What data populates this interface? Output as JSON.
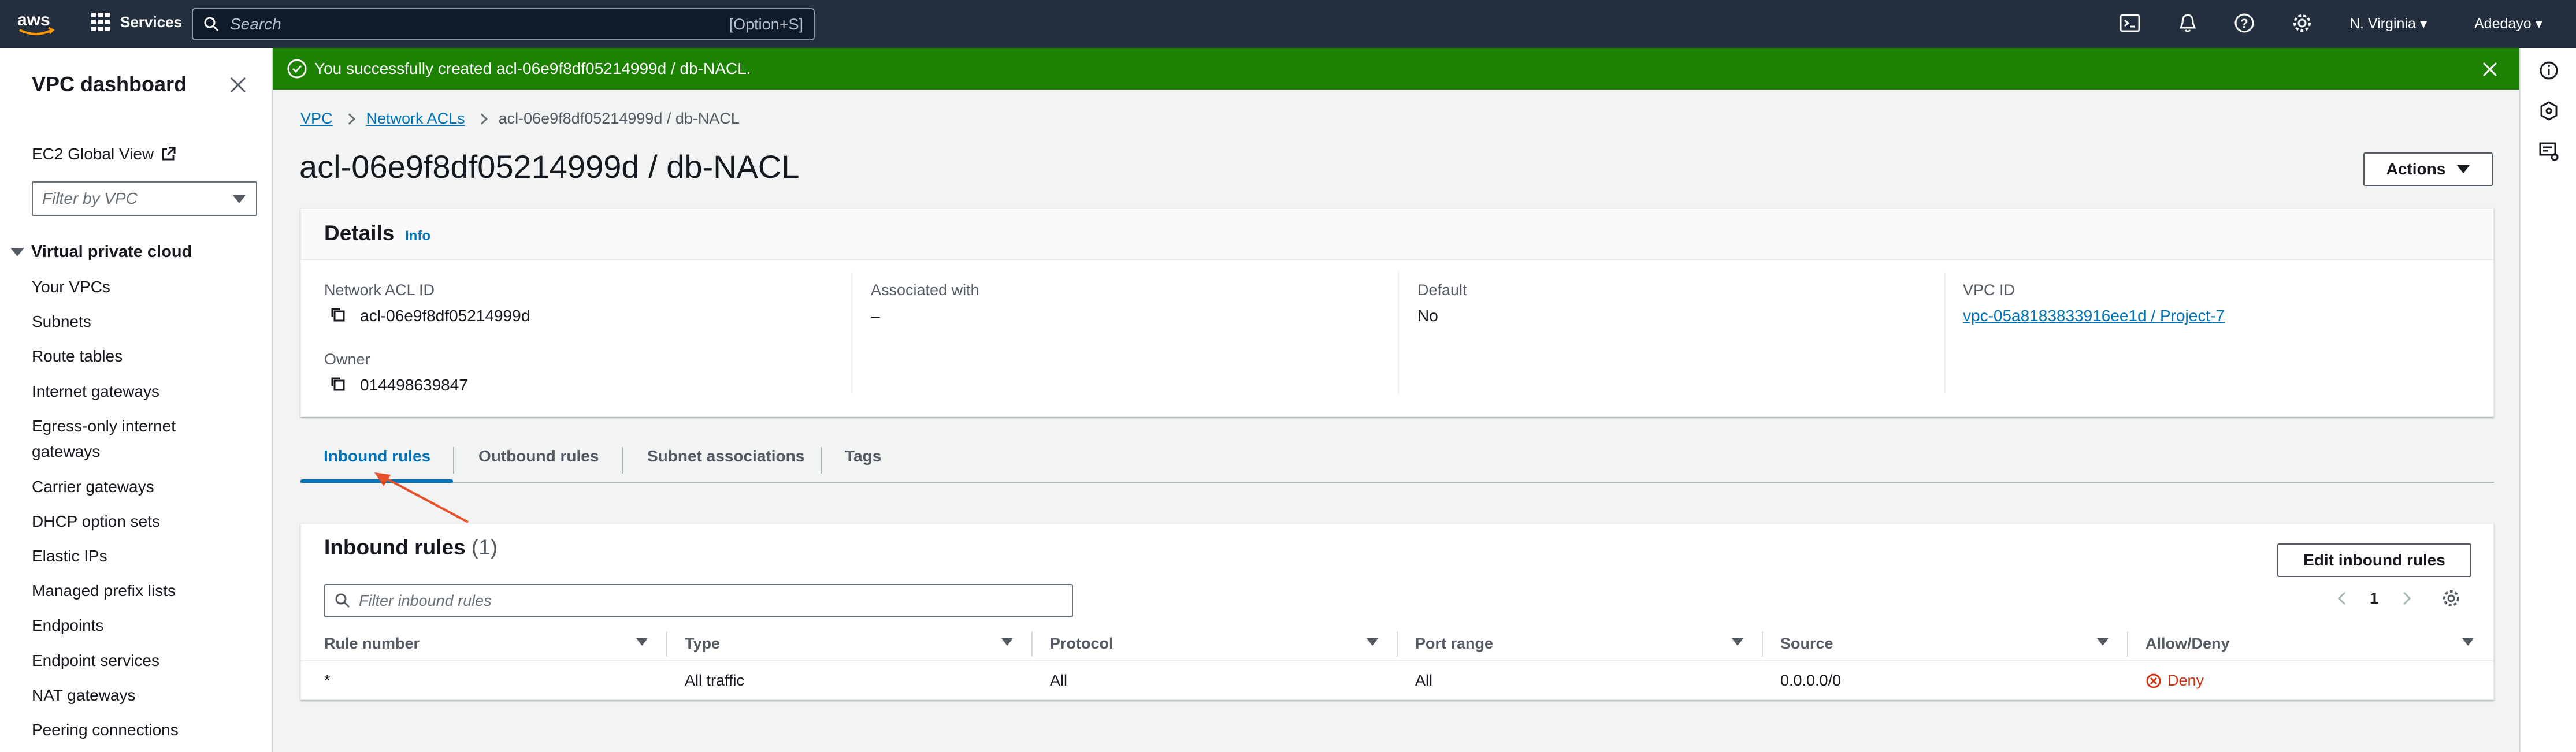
{
  "topnav": {
    "logo_text": "aws",
    "services_label": "Services",
    "search_placeholder": "Search",
    "search_shortcut": "[Option+S]",
    "region": "N. Virginia",
    "user": "Adedayo",
    "icons": [
      "cloudshell-icon",
      "bell-icon",
      "help-icon",
      "gear-icon"
    ]
  },
  "sidebar": {
    "title": "VPC dashboard",
    "ec2_global_view": "EC2 Global View",
    "filter_placeholder": "Filter by VPC",
    "section": "Virtual private cloud",
    "items": [
      "Your VPCs",
      "Subnets",
      "Route tables",
      "Internet gateways",
      "Egress-only internet",
      "gateways",
      "Carrier gateways",
      "DHCP option sets",
      "Elastic IPs",
      "Managed prefix lists",
      "Endpoints",
      "Endpoint services",
      "NAT gateways",
      "Peering connections"
    ]
  },
  "flash": {
    "message": "You successfully created acl-06e9f8df05214999d / db-NACL.",
    "color": "#1d8102"
  },
  "breadcrumb": {
    "vpc": "VPC",
    "network_acls": "Network ACLs",
    "current": "acl-06e9f8df05214999d / db-NACL"
  },
  "page": {
    "title": "acl-06e9f8df05214999d / db-NACL",
    "actions_label": "Actions"
  },
  "details": {
    "title": "Details",
    "info": "Info",
    "network_acl_id_label": "Network ACL ID",
    "network_acl_id": "acl-06e9f8df05214999d",
    "owner_label": "Owner",
    "owner": "014498639847",
    "associated_label": "Associated with",
    "associated": "–",
    "default_label": "Default",
    "default": "No",
    "vpc_id_label": "VPC ID",
    "vpc_id": "vpc-05a8183833916ee1d / Project-7"
  },
  "tabs": {
    "inbound": "Inbound rules",
    "outbound": "Outbound rules",
    "subnet": "Subnet associations",
    "tags": "Tags"
  },
  "rules": {
    "title": "Inbound rules",
    "count": "(1)",
    "edit_label": "Edit inbound rules",
    "filter_placeholder": "Filter inbound rules",
    "page": "1",
    "columns": [
      "Rule number",
      "Type",
      "Protocol",
      "Port range",
      "Source",
      "Allow/Deny"
    ],
    "rows": [
      {
        "rule_number": "*",
        "type": "All traffic",
        "protocol": "All",
        "port_range": "All",
        "source": "0.0.0.0/0",
        "action": "Deny"
      }
    ]
  },
  "colors": {
    "nav": "#232f3e",
    "link": "#0073bb",
    "deny": "#d13212",
    "annotation": "#e8502a"
  }
}
